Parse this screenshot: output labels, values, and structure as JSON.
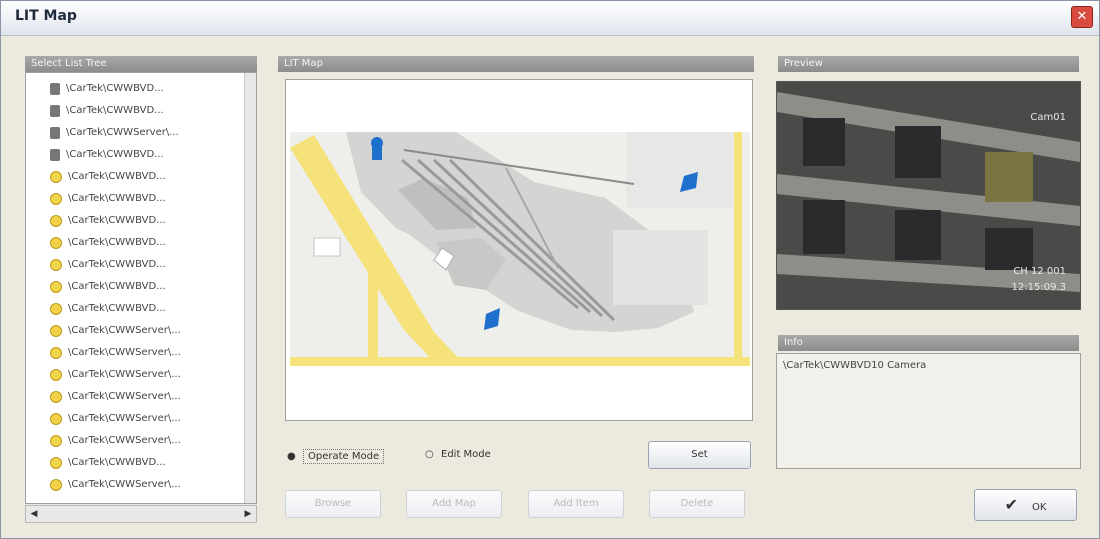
{
  "window": {
    "title": "LIT Map",
    "close_label": "✕"
  },
  "left_panel": {
    "title": "Select List Tree",
    "items": [
      {
        "icon": "camera",
        "label": "\\CarTek\\CWWBVD..."
      },
      {
        "icon": "camera",
        "label": "\\CarTek\\CWWBVD..."
      },
      {
        "icon": "camera",
        "label": "\\CarTek\\CWWServer\\..."
      },
      {
        "icon": "camera",
        "label": "\\CarTek\\CWWBVD..."
      },
      {
        "icon": "bulb",
        "label": "\\CarTek\\CWWBVD..."
      },
      {
        "icon": "bulb",
        "label": "\\CarTek\\CWWBVD..."
      },
      {
        "icon": "bulb",
        "label": "\\CarTek\\CWWBVD..."
      },
      {
        "icon": "bulb",
        "label": "\\CarTek\\CWWBVD..."
      },
      {
        "icon": "bulb",
        "label": "\\CarTek\\CWWBVD..."
      },
      {
        "icon": "bulb",
        "label": "\\CarTek\\CWWBVD..."
      },
      {
        "icon": "bulb",
        "label": "\\CarTek\\CWWBVD..."
      },
      {
        "icon": "bulb",
        "label": "\\CarTek\\CWWServer\\..."
      },
      {
        "icon": "bulb",
        "label": "\\CarTek\\CWWServer\\..."
      },
      {
        "icon": "bulb",
        "label": "\\CarTek\\CWWServer\\..."
      },
      {
        "icon": "bulb",
        "label": "\\CarTek\\CWWServer\\..."
      },
      {
        "icon": "bulb",
        "label": "\\CarTek\\CWWServer\\..."
      },
      {
        "icon": "bulb",
        "label": "\\CarTek\\CWWServer\\..."
      },
      {
        "icon": "bulb",
        "label": "\\CarTek\\CWWBVD..."
      },
      {
        "icon": "bulb",
        "label": "\\CarTek\\CWWServer\\..."
      }
    ]
  },
  "map_panel": {
    "title": "LIT Map",
    "operate_mode_label": "Operate Mode",
    "edit_mode_label": "Edit Mode",
    "set_button": "Set",
    "bottom_buttons": [
      "Browse",
      "Add Map",
      "Add Item",
      "Delete"
    ]
  },
  "preview_panel": {
    "title": "Preview",
    "cam_label": "Cam01",
    "timestamp_1": "CH 12 001",
    "timestamp_2": "12:15:09.3"
  },
  "info_panel": {
    "title": "Info",
    "text": "\\CarTek\\CWWBVD10 Camera"
  },
  "ok_button": "OK",
  "colors": {
    "accent": "#8c8c8c",
    "map_road": "#f6e27a",
    "marker": "#1f6fcc"
  }
}
